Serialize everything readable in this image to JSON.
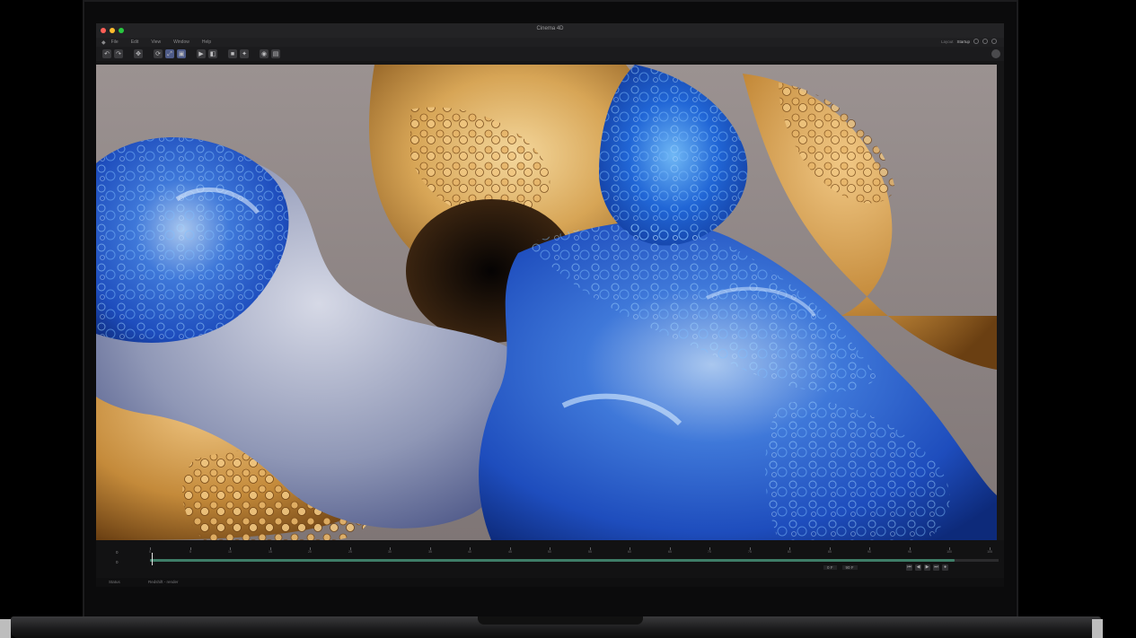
{
  "window": {
    "title": "Cinema 4D"
  },
  "menubar": {
    "items": [
      "File",
      "Edit",
      "View",
      "Window",
      "Help"
    ],
    "right_status": "Layout",
    "right_accent": "Startup"
  },
  "timeline": {
    "start_frame_label": "0",
    "current_frame_label": "0",
    "ruler_labels": [
      "0",
      "5",
      "10",
      "15",
      "20",
      "25",
      "30",
      "35",
      "40",
      "45",
      "50",
      "55",
      "60",
      "65",
      "70",
      "75",
      "80",
      "85",
      "90",
      "95",
      "100",
      "105"
    ],
    "field_start": "0 F",
    "field_end": "90 F",
    "progress_fraction": 0.948,
    "transport": [
      "⏮",
      "◀",
      "▶",
      "⏭",
      "●"
    ]
  },
  "status": {
    "left": "Status",
    "message": "Redshift - render"
  },
  "colors": {
    "accent": "#4e5b88",
    "track": "#3e7d67",
    "background": "#000000"
  },
  "icons": {
    "toolbar": [
      "undo-icon",
      "redo-icon",
      "move-icon",
      "rotate-icon",
      "scale-icon",
      "select-icon",
      "render-icon",
      "render-settings-icon",
      "cube-icon",
      "light-icon",
      "camera-icon",
      "view-icon",
      "settings-icon"
    ]
  }
}
